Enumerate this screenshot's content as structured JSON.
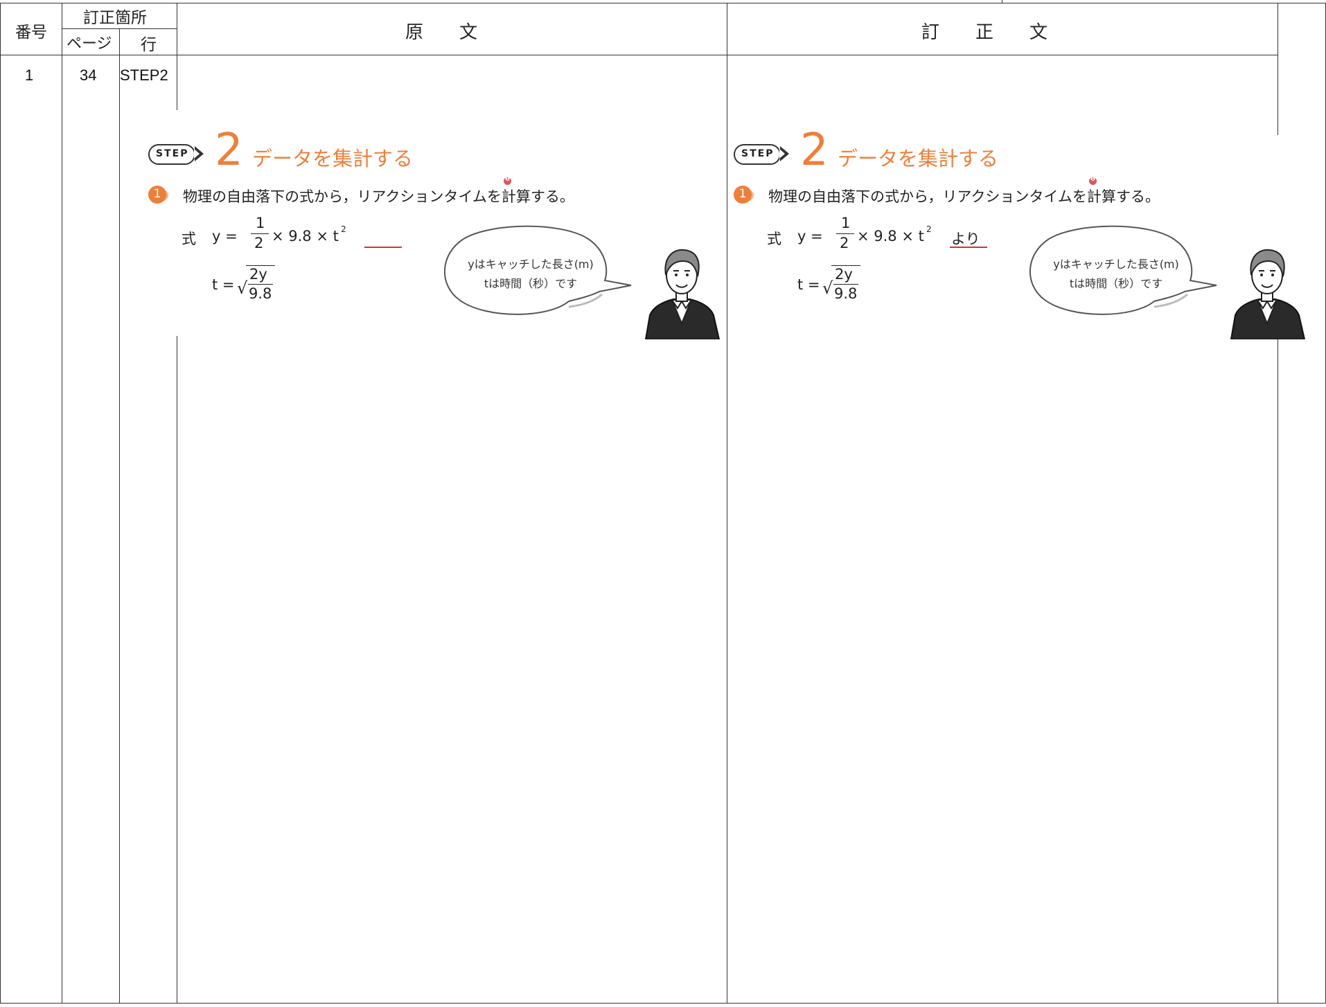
{
  "table_header": {
    "number": "番号",
    "location": "訂正箇所",
    "page": "ページ",
    "line": "行",
    "original": "原　　文",
    "corrected": "訂　　正　　文"
  },
  "rows": [
    {
      "number": "1",
      "page": "34",
      "line": "STEP2"
    }
  ],
  "step_label": "STEP",
  "step_number": "2",
  "step_title": "データを集計する",
  "question_number": "1",
  "question_text": "物理の自由落下の式から，リアクションタイムを計算する。",
  "ref_marker": "❶",
  "formula": {
    "label": "式",
    "y_eq": "y =",
    "numerator": "1",
    "denominator": "2",
    "rest": "× 9.8 × t",
    "exponent": "2",
    "t_eq": "t =",
    "sqrt_symbol": "√",
    "sqrt_num": "2y",
    "sqrt_den": "9.8"
  },
  "original_addition": "",
  "corrected_addition": "より",
  "bubble": {
    "line1": "yはキャッチした長さ(m)",
    "line2": "tは時間（秒）です"
  },
  "colors": {
    "accent": "#ee7f3a",
    "underline": "#d9302a",
    "marker": "#e05560",
    "rule": "#333333"
  }
}
